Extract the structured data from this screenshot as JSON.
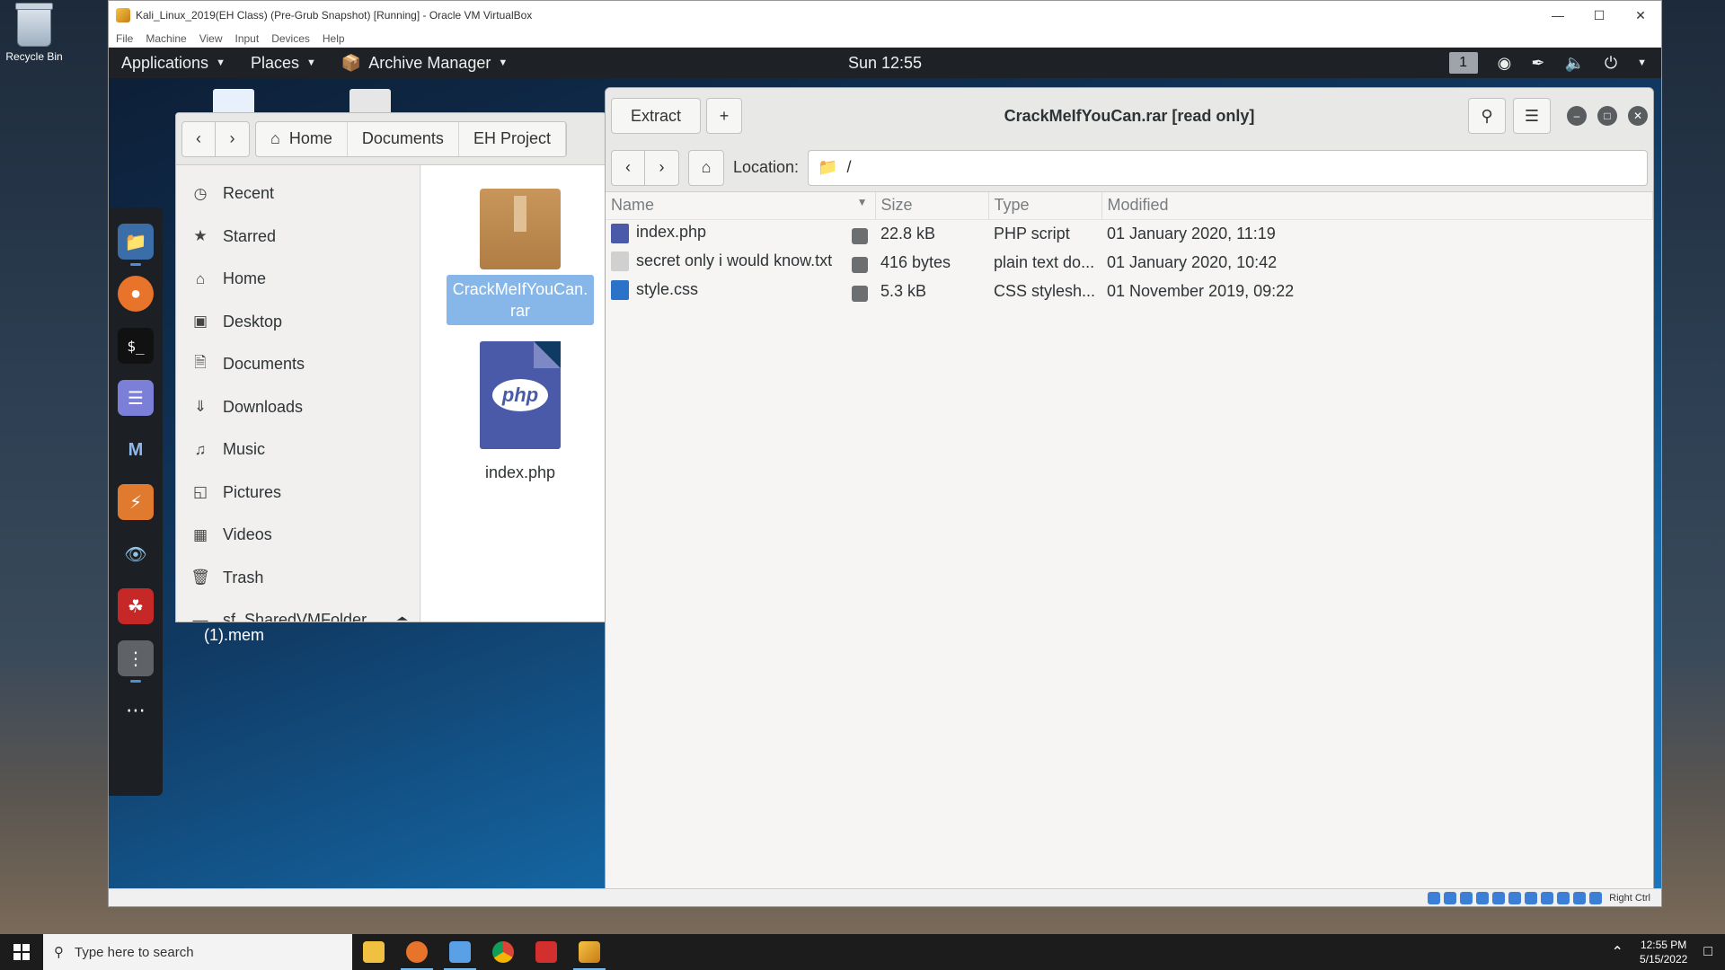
{
  "desktop": {
    "recycle_bin": "Recycle Bin"
  },
  "vbox": {
    "title": "Kali_Linux_2019(EH Class) (Pre-Grub Snapshot) [Running] - Oracle VM VirtualBox",
    "menu": [
      "File",
      "Machine",
      "View",
      "Input",
      "Devices",
      "Help"
    ],
    "status_key": "Right Ctrl"
  },
  "gnome": {
    "applications": "Applications",
    "places": "Places",
    "archive_manager": "Archive Manager",
    "clock": "Sun 12:55",
    "workspace": "1"
  },
  "nautilus": {
    "crumbs": [
      "Home",
      "Documents",
      "EH Project"
    ],
    "sidebar": [
      {
        "label": "Recent",
        "icon": "clock-icon"
      },
      {
        "label": "Starred",
        "icon": "star-icon"
      },
      {
        "label": "Home",
        "icon": "home-icon"
      },
      {
        "label": "Desktop",
        "icon": "desktop-icon"
      },
      {
        "label": "Documents",
        "icon": "document-icon"
      },
      {
        "label": "Downloads",
        "icon": "download-icon"
      },
      {
        "label": "Music",
        "icon": "music-icon"
      },
      {
        "label": "Pictures",
        "icon": "pictures-icon"
      },
      {
        "label": "Videos",
        "icon": "video-icon"
      },
      {
        "label": "Trash",
        "icon": "trash-icon"
      },
      {
        "label": "sf_SharedVMFolder",
        "icon": "drive-icon"
      }
    ],
    "files": [
      {
        "name": "CrackMeIfYouCan.\nrar",
        "selected": true
      },
      {
        "name": "index.php",
        "selected": false
      }
    ],
    "desktop_mem_label": "(1).mem"
  },
  "archive": {
    "extract_label": "Extract",
    "add_label": "+",
    "title": "CrackMeIfYouCan.rar [read only]",
    "location_label": "Location:",
    "location_path": "/",
    "columns": [
      "Name",
      "Size",
      "Type",
      "Modified"
    ],
    "rows": [
      {
        "name": "index.php",
        "size": "22.8 kB",
        "type": "PHP script",
        "modified": "01 January 2020, 11:19",
        "icon_color": "#4b5aa8"
      },
      {
        "name": "secret only i would know.txt",
        "size": "416 bytes",
        "type": "plain text do...",
        "modified": "01 January 2020, 10:42",
        "icon_color": "#d0d0d0"
      },
      {
        "name": "style.css",
        "size": "5.3 kB",
        "type": "CSS stylesh...",
        "modified": "01 November 2019, 09:22",
        "icon_color": "#2a73c9"
      }
    ]
  },
  "taskbar": {
    "search_placeholder": "Type here to search",
    "time": "12:55 PM",
    "date": "5/15/2022"
  }
}
